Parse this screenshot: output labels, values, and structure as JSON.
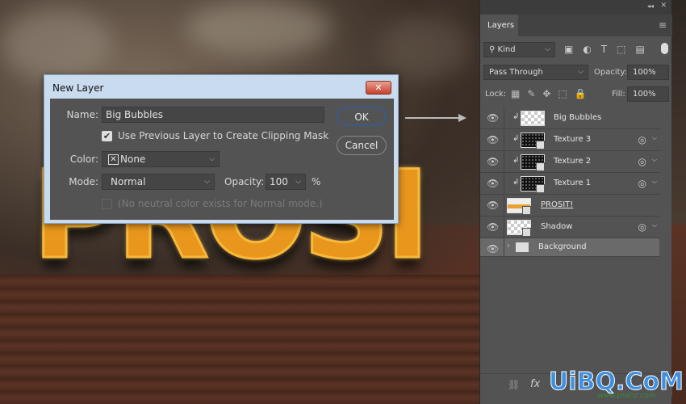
{
  "scene": {
    "text": "PROSI"
  },
  "dialog": {
    "title": "New Layer",
    "close": "✕",
    "name_label": "Name:",
    "name_value": "Big Bubbles",
    "clip_label": "Use Previous Layer to Create Clipping Mask",
    "clip_checked": true,
    "color_label": "Color:",
    "color_value": "None",
    "mode_label": "Mode:",
    "mode_value": "Normal",
    "opacity_label": "Opacity:",
    "opacity_value": "100",
    "percent": "%",
    "neutral_label": "(No neutral color exists for Normal mode.)",
    "ok": "OK",
    "cancel": "Cancel"
  },
  "panel": {
    "collapse": "◂◂",
    "close": "✕",
    "tab": "Layers",
    "filter": "Kind",
    "blend": "Pass Through",
    "opacity_label": "Opacity:",
    "opacity_value": "100%",
    "lock_label": "Lock:",
    "fill_label": "Fill:",
    "fill_value": "100%",
    "layers": [
      {
        "name": "Big Bubbles",
        "clipped": true,
        "thumb": "transparent"
      },
      {
        "name": "Texture 3",
        "clipped": true,
        "thumb": "dark",
        "fx": true
      },
      {
        "name": "Texture 2",
        "clipped": true,
        "thumb": "dark",
        "fx": true
      },
      {
        "name": "Texture 1",
        "clipped": true,
        "thumb": "dark",
        "fx": true
      },
      {
        "name": "PROSIT!",
        "clipped": false,
        "thumb": "text"
      },
      {
        "name": "Shadow",
        "clipped": false,
        "thumb": "transparent",
        "fx": true
      },
      {
        "name": "Background",
        "group": true,
        "selected": true
      }
    ],
    "bottom": {
      "link": "⛓",
      "fx": "fx"
    }
  },
  "watermark": {
    "text": "UiBQ.CoM",
    "sub": "www.psahz.com"
  }
}
